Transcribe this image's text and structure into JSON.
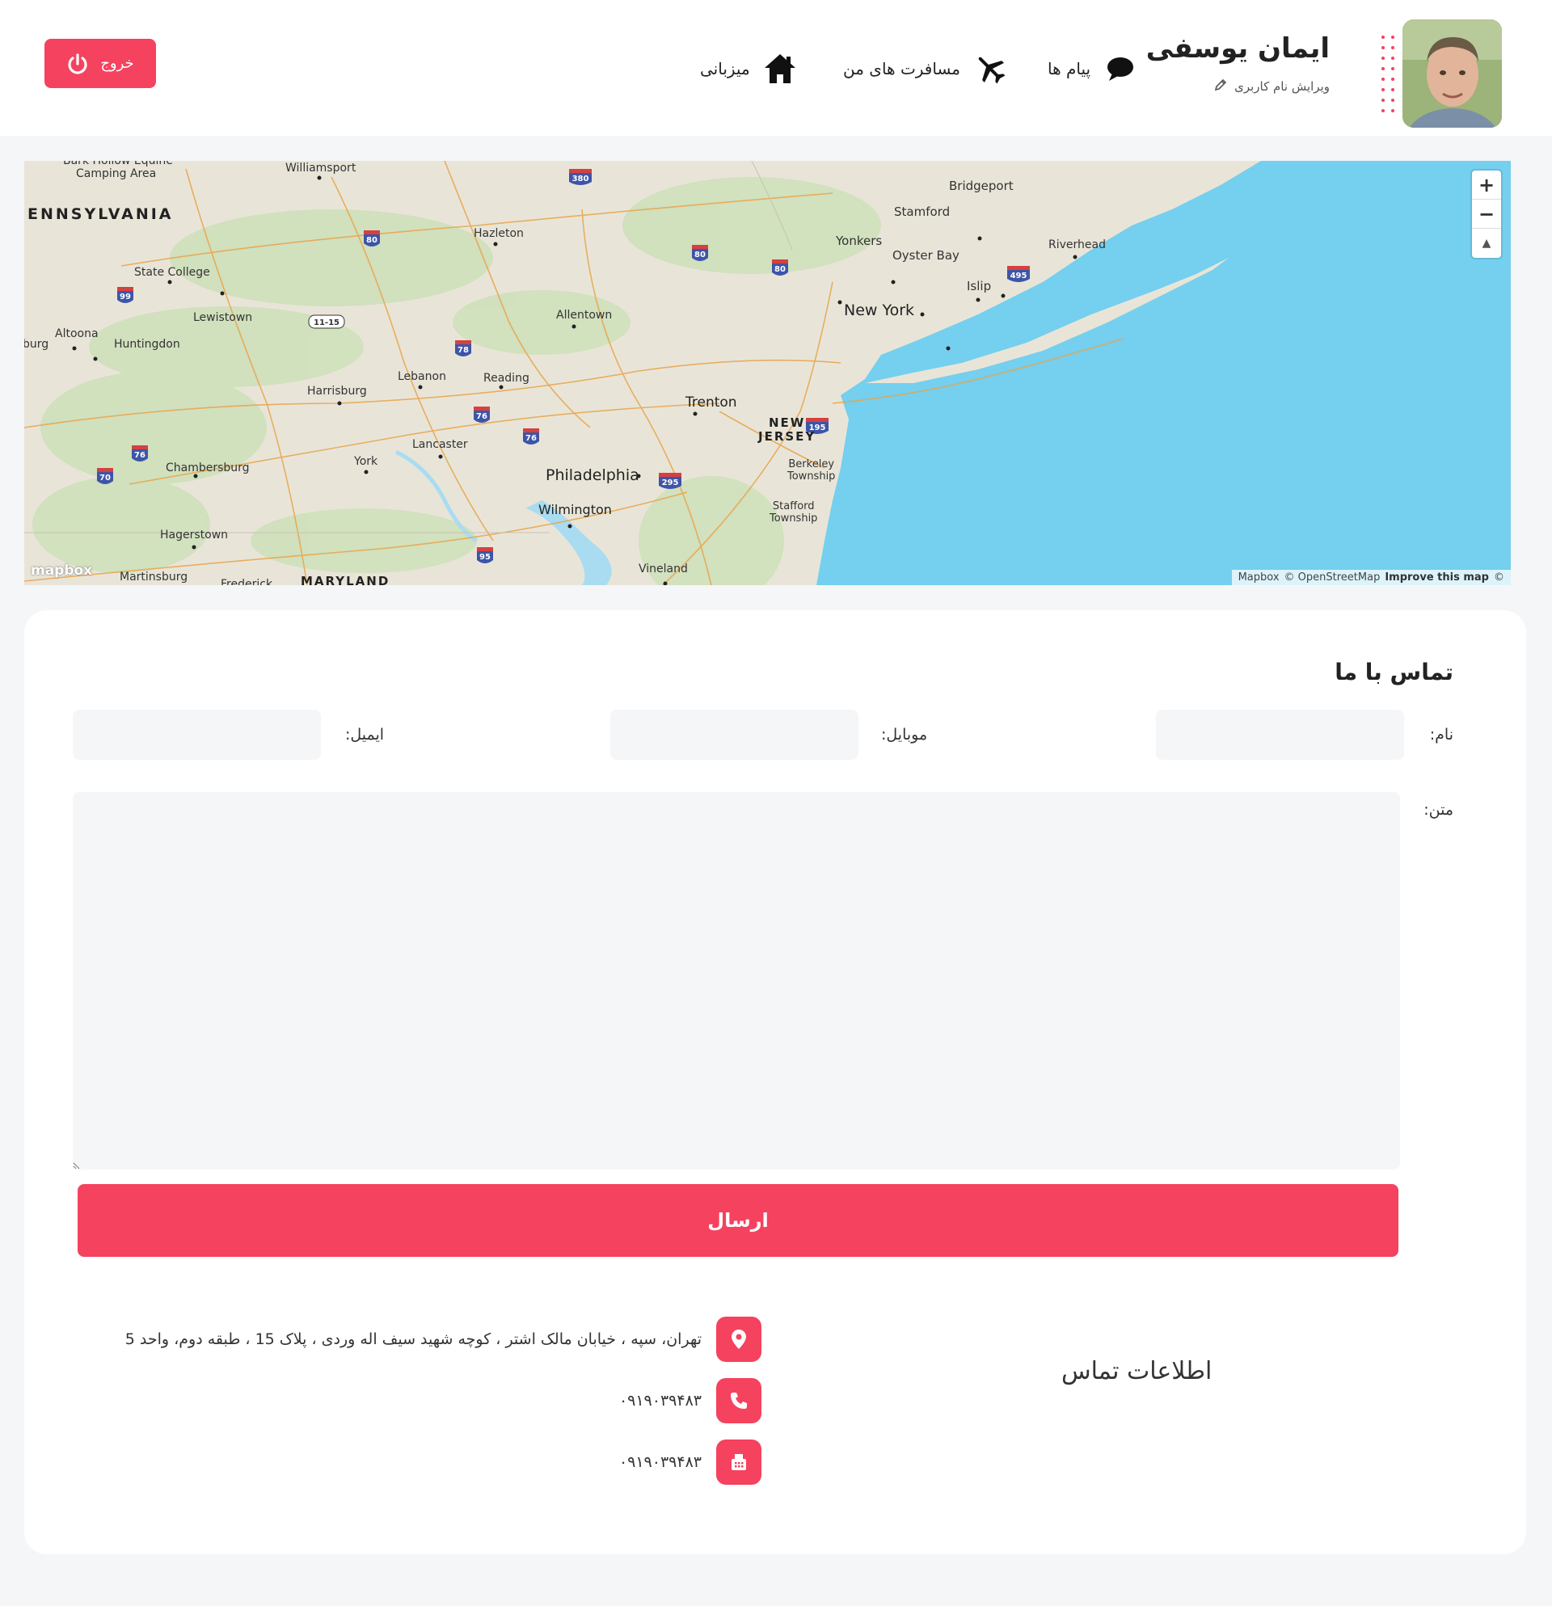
{
  "header": {
    "logout_label": "خروج",
    "nav": {
      "host_label": "میزبانی",
      "trips_label": "مسافرت های من",
      "messages_label": "پیام ها"
    },
    "profile": {
      "name": "ایمان یوسفی",
      "edit_username_label": "ویرایش نام کاربری"
    }
  },
  "map": {
    "attribution_mapbox": "Mapbox",
    "attribution_osm": "© OpenStreetMap",
    "improve_label": "Improve this map",
    "copyright_icon": "©",
    "logo": "mapbox",
    "zoom_in": "+",
    "zoom_out": "−",
    "compass": "▲",
    "places": {
      "bark_hollow": "Bark Hollow Equine",
      "camping_area": "Camping Area",
      "williamsport": "Williamsport",
      "pennsylvania": "ENNSYLVANIA",
      "hazleton": "Hazleton",
      "state_college": "State College",
      "lewistown": "Lewistown",
      "altoona": "Altoona",
      "huntingdon": "Huntingdon",
      "burg": "burg",
      "allentown": "Allentown",
      "lebanon": "Lebanon",
      "reading": "Reading",
      "harrisburg": "Harrisburg",
      "lancaster": "Lancaster",
      "york": "York",
      "chambersburg": "Chambersburg",
      "hagerstown": "Hagerstown",
      "martinsburg": "Martinsburg",
      "maryland": "MARYLAND",
      "frederick": "Frederick",
      "philadelphia": "Philadelphia",
      "wilmington": "Wilmington",
      "vineland": "Vineland",
      "trenton": "Trenton",
      "new_jersey_1": "NEW",
      "new_jersey_2": "JERSEY",
      "berkeley": "Berkeley",
      "berkeley_2": "Township",
      "stafford": "Stafford",
      "stafford_2": "Township",
      "new_york": "New York",
      "yonkers": "Yonkers",
      "stamford": "Stamford",
      "bridgeport": "Bridgeport",
      "oyster_bay": "Oyster Bay",
      "islip": "Islip",
      "riverhead": "Riverhead"
    },
    "shields": {
      "i380": "380",
      "i80a": "80",
      "i80b": "80",
      "i80c": "80",
      "i99": "99",
      "us1115": "11-15",
      "i78": "78",
      "i76a": "76",
      "i76b": "76",
      "i76c": "76",
      "i70": "70",
      "i295": "295",
      "i195": "195",
      "i95": "95",
      "i495": "495"
    }
  },
  "contact": {
    "title": "تماس با ما",
    "name_label": "نام:",
    "mobile_label": "موبایل:",
    "email_label": "ایمیل:",
    "text_label": "متن:",
    "name_value": "",
    "mobile_value": "",
    "email_value": "",
    "text_value": "",
    "submit_label": "ارسال",
    "info_title": "اطلاعات تماس",
    "address": "تهران، سپه ، خیابان مالک اشتر ، کوچه شهید سیف اله وردی ، پلاک 15 ، طبقه دوم، واحد 5",
    "phone": "۰۹۱۹۰۳۹۴۸۳",
    "fax": "۰۹۱۹۰۳۹۴۸۳"
  },
  "colors": {
    "accent": "#f5425f",
    "page_bg": "#f5f6f8",
    "water": "#75cfee",
    "land": "#e9e6da"
  },
  "icons": {
    "logout": "power-icon",
    "host": "home-icon",
    "trips": "airplane-icon",
    "messages": "chat-bubble-icon",
    "edit": "pencil-icon",
    "address": "location-pin-icon",
    "phone": "phone-icon",
    "fax": "fax-icon"
  }
}
